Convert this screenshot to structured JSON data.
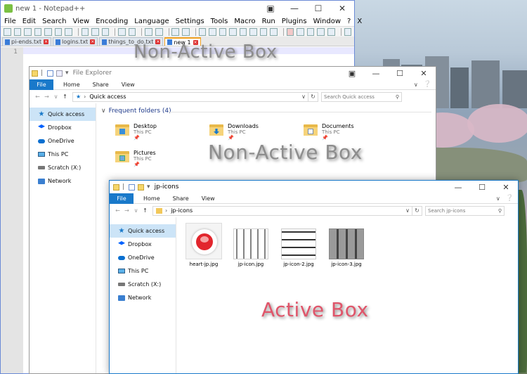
{
  "overlays": {
    "top": "Non-Active Box",
    "middle": "Non-Active Box",
    "bottom": "Active Box"
  },
  "notepad": {
    "title": "new 1 - Notepad++",
    "menu": [
      "File",
      "Edit",
      "Search",
      "View",
      "Encoding",
      "Language",
      "Settings",
      "Tools",
      "Macro",
      "Run",
      "Plugins",
      "Window",
      "?"
    ],
    "menu_close": "X",
    "tabs": [
      {
        "label": "pi-ends.txt",
        "active": false
      },
      {
        "label": "logins.txt",
        "active": false
      },
      {
        "label": "things_to_do.txt",
        "active": false
      },
      {
        "label": "new 1",
        "active": true
      }
    ],
    "line_number": "1"
  },
  "fe1": {
    "title": "File Explorer",
    "ribbon": {
      "file": "File",
      "tabs": [
        "Home",
        "Share",
        "View"
      ]
    },
    "address": "Quick access",
    "search_placeholder": "Search Quick access",
    "nav": [
      "Quick access",
      "Dropbox",
      "OneDrive",
      "This PC",
      "Scratch (X:)",
      "Network"
    ],
    "section": "Frequent folders (4)",
    "folders": [
      {
        "name": "Desktop",
        "sub": "This PC"
      },
      {
        "name": "Downloads",
        "sub": "This PC"
      },
      {
        "name": "Documents",
        "sub": "This PC"
      },
      {
        "name": "Pictures",
        "sub": "This PC"
      }
    ]
  },
  "fe2": {
    "title": "jp-icons",
    "ribbon": {
      "file": "File",
      "tabs": [
        "Home",
        "Share",
        "View"
      ]
    },
    "address": "jp-icons",
    "search_placeholder": "Search jp-icons",
    "nav": [
      "Quick access",
      "Dropbox",
      "OneDrive",
      "This PC",
      "Scratch (X:)",
      "Network"
    ],
    "files": [
      {
        "name": "heart-jp.jpg"
      },
      {
        "name": "jp-icon.jpg"
      },
      {
        "name": "jp-icon-2.jpg"
      },
      {
        "name": "jp-icon-3.jpg"
      }
    ]
  },
  "colors": {
    "accent": "#1979ca",
    "active_label": "#e0556a",
    "inactive_label": "#8d8d8d",
    "notepad_border": "#6b8bd6"
  }
}
